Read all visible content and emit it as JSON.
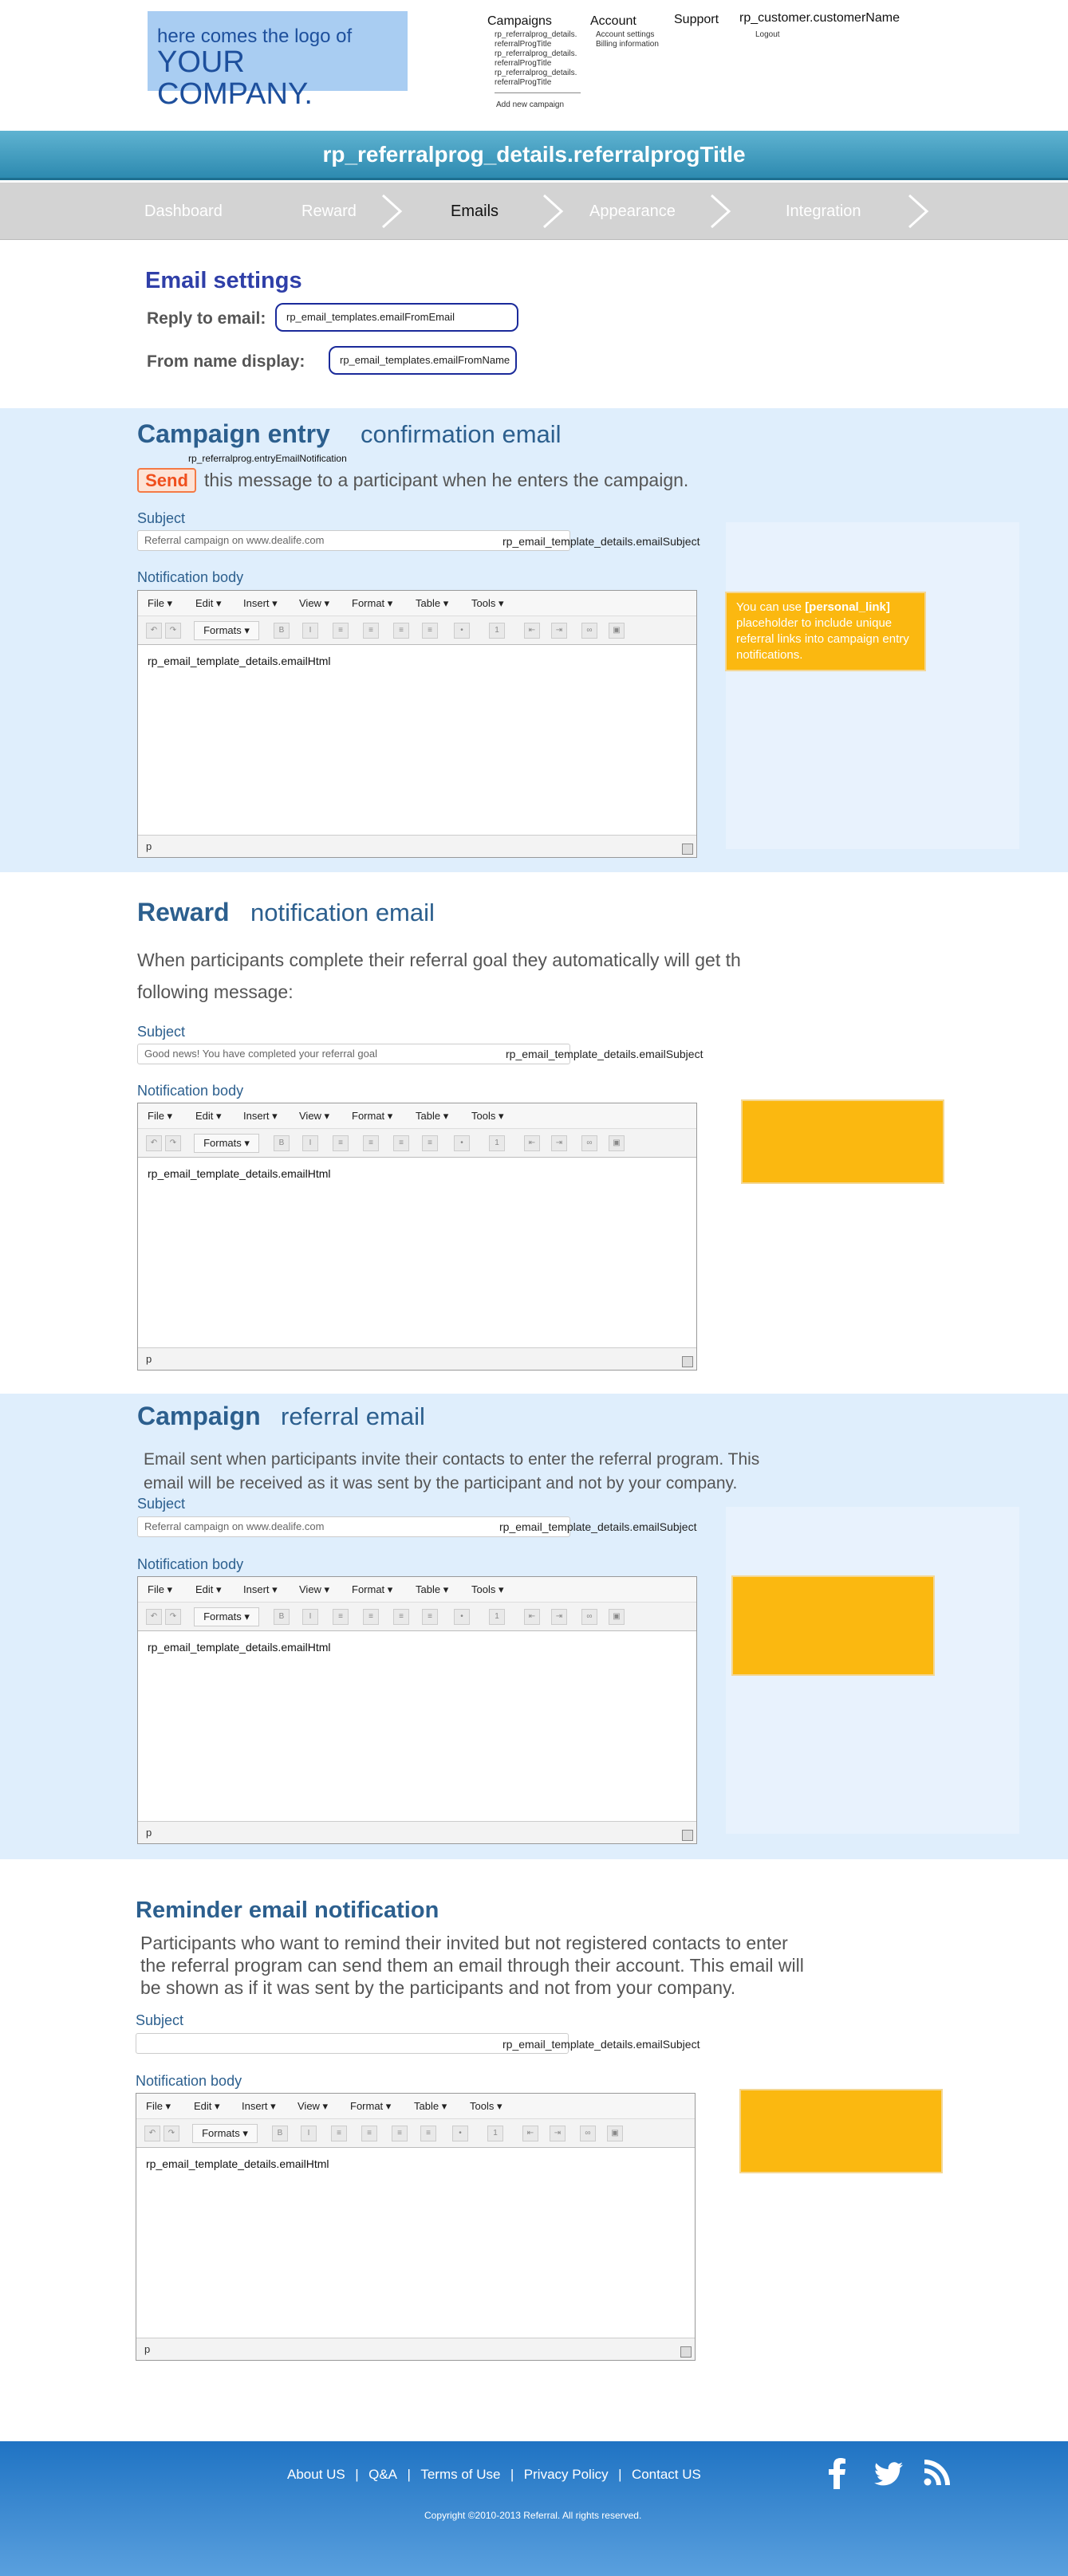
{
  "logo": {
    "line1": "here comes the logo of",
    "line2": "YOUR COMPANY."
  },
  "topnav": {
    "campaigns": {
      "label": "Campaigns",
      "items": [
        "rp_referralprog_details.",
        "referralProgTitle",
        "rp_referralprog_details.",
        "referralProgTitle",
        "rp_referralprog_details.",
        "referralProgTitle"
      ],
      "add_new": "Add new campaign"
    },
    "account": {
      "label": "Account",
      "items": [
        "Account settings",
        "Billing information"
      ]
    },
    "support": {
      "label": "Support"
    },
    "customer": {
      "label": "rp_customer.customerName",
      "logout": "Logout"
    }
  },
  "title": "rp_referralprog_details.referralprogTitle",
  "steps": [
    {
      "label": "Dashboard",
      "active": false
    },
    {
      "label": "Reward",
      "active": false
    },
    {
      "label": "Emails",
      "active": true
    },
    {
      "label": "Appearance",
      "active": false
    },
    {
      "label": "Integration",
      "active": false
    }
  ],
  "email_settings": {
    "heading": "Email settings",
    "reply_label": "Reply to email:",
    "reply_value": "rp_email_templates.emailFromEmail",
    "from_label": "From name display:",
    "from_value": "rp_email_templates.emailFromName"
  },
  "sections": {
    "entry": {
      "title_bold": "Campaign entry",
      "title_rest": "confirmation email",
      "note": "rp_referralprog.entryEmailNotification",
      "send_label": "Send",
      "desc": "this message to a participant when he enters the campaign.",
      "subject_label": "Subject",
      "subject_value": "Referral campaign on www.dealife.com",
      "subject_bind": "rp_email_template_details.emailSubject",
      "body_label": "Notification body",
      "body_html": "rp_email_template_details.emailHtml",
      "tip_prefix": "You can use ",
      "tip_code": "[personal_link]",
      "tip_rest": " placeholder to include unique referral links into campaign entry notifications."
    },
    "reward": {
      "title_bold": "Reward",
      "title_rest": "notification email",
      "desc_line1": "When participants complete their referral goal they automatically will get th",
      "desc_line2": "following message:",
      "subject_label": "Subject",
      "subject_value": "Good news! You have completed your referral goal",
      "subject_bind": "rp_email_template_details.emailSubject",
      "body_label": "Notification body",
      "body_html": "rp_email_template_details.emailHtml"
    },
    "referral": {
      "title_bold": "Campaign",
      "title_rest": "referral email",
      "desc_line1": "Email sent when participants invite their contacts to enter the referral program. This",
      "desc_line2": "email will be received as it was sent by the participant and not by your company.",
      "subject_label": "Subject",
      "subject_value": "Referral campaign on www.dealife.com",
      "subject_bind": "rp_email_template_details.emailSubject",
      "body_label": "Notification body",
      "body_html": "rp_email_template_details.emailHtml"
    },
    "reminder": {
      "title": "Reminder email notification",
      "desc_line1": "Participants who want to remind their invited but not registered contacts to enter",
      "desc_line2": "the referral program can send them an email through their account.  This email will",
      "desc_line3": "be shown as if it was sent by the participants and not from your company.",
      "subject_label": "Subject",
      "subject_value": "",
      "subject_bind": "rp_email_template_details.emailSubject",
      "body_label": "Notification body",
      "body_html": "rp_email_template_details.emailHtml"
    }
  },
  "editor": {
    "menus": [
      "File ▾",
      "Edit ▾",
      "Insert ▾",
      "View ▾",
      "Format ▾",
      "Table ▾",
      "Tools ▾"
    ],
    "formats": "Formats ▾",
    "status_path": "p"
  },
  "footer": {
    "links": [
      "About US",
      "Q&A",
      "Terms of Use",
      "Privacy Policy",
      "Contact US"
    ],
    "separator": "|",
    "copyright": "Copyright ©2010-2013 Referral. All rights reserved."
  },
  "colors": {
    "accent": "#2c5f8e",
    "title_bar": "#2d8ab0",
    "band": "#dfeefc",
    "tip": "#fbb810",
    "send": "#f47a46",
    "footer": "#1f73c3"
  }
}
